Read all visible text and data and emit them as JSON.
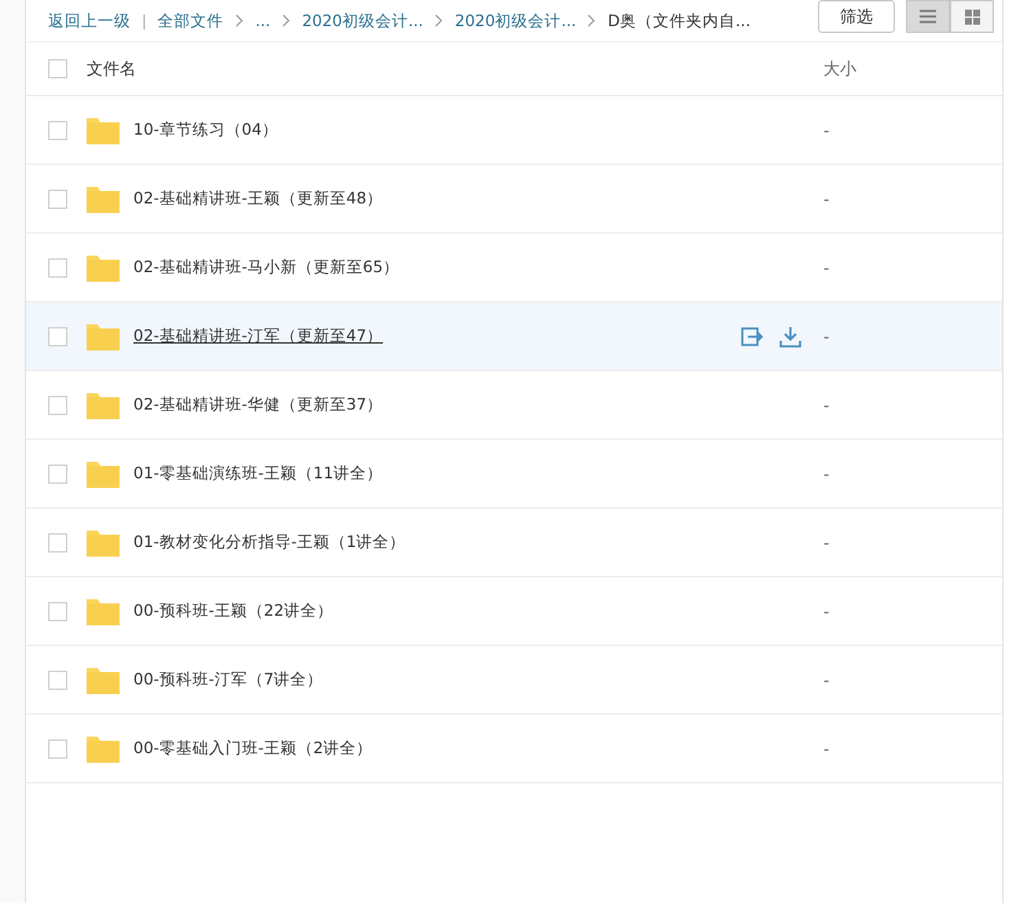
{
  "toolbar": {
    "back": "返回上一级",
    "separator": "|",
    "breadcrumbs": [
      {
        "label": "全部文件",
        "current": false
      },
      {
        "label": "...",
        "current": false
      },
      {
        "label": "2020初级会计...",
        "current": false
      },
      {
        "label": "2020初级会计...",
        "current": false
      },
      {
        "label": "D奥（文件夹内自...",
        "current": true
      }
    ],
    "filter_button": "筛选",
    "views": [
      {
        "kind": "list",
        "selected": true
      },
      {
        "kind": "grid",
        "selected": false
      }
    ]
  },
  "table": {
    "select_all_checked": false,
    "columns": [
      "文件名",
      "大小"
    ],
    "rows": [
      {
        "name": "10-章节练习（04）",
        "size": "-",
        "hovered": false,
        "checked": false
      },
      {
        "name": "02-基础精讲班-王颖（更新至48）",
        "size": "-",
        "hovered": false,
        "checked": false
      },
      {
        "name": "02-基础精讲班-马小新（更新至65）",
        "size": "-",
        "hovered": false,
        "checked": false
      },
      {
        "name": "02-基础精讲班-汀军（更新至47）",
        "size": "-",
        "hovered": true,
        "checked": false
      },
      {
        "name": "02-基础精讲班-华健（更新至37）",
        "size": "-",
        "hovered": false,
        "checked": false
      },
      {
        "name": "01-零基础演练班-王颖（11讲全）",
        "size": "-",
        "hovered": false,
        "checked": false
      },
      {
        "name": "01-教材变化分析指导-王颖（1讲全）",
        "size": "-",
        "hovered": false,
        "checked": false
      },
      {
        "name": "00-预科班-王颖（22讲全）",
        "size": "-",
        "hovered": false,
        "checked": false
      },
      {
        "name": "00-预科班-汀军（7讲全）",
        "size": "-",
        "hovered": false,
        "checked": false
      },
      {
        "name": "00-零基础入门班-王颖（2讲全）",
        "size": "-",
        "hovered": false,
        "checked": false
      }
    ]
  }
}
